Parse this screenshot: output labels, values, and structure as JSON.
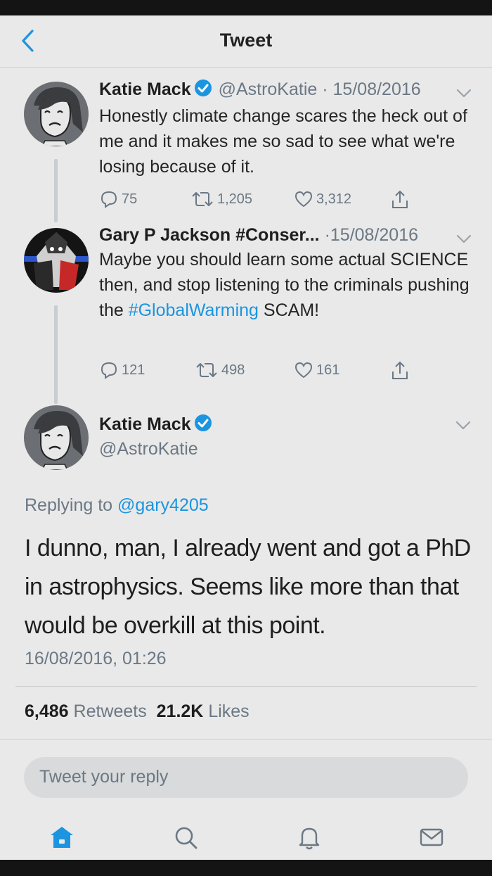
{
  "header": {
    "title": "Tweet"
  },
  "tweets": [
    {
      "name": "Katie Mack",
      "handle": "@AstroKatie",
      "dot": "·",
      "date": "15/08/2016",
      "text": "Honestly climate change scares the heck out of me and it makes me so sad to see what we're losing because of it.",
      "replies": "75",
      "retweets": "1,205",
      "likes": "3,312"
    },
    {
      "name": "Gary P Jackson #Conser...",
      "dot": "·",
      "date": "15/08/2016",
      "text_before": "Maybe you should learn some actual SCIENCE then, and stop listening to the criminals pushing the ",
      "hashtag": "#GlobalWarming",
      "text_after": " SCAM!",
      "replies": "121",
      "retweets": "498",
      "likes": "161"
    }
  ],
  "main_tweet": {
    "name": "Katie Mack",
    "handle": "@AstroKatie",
    "replying_label": "Replying to",
    "replying_handle": "@gary4205",
    "text": "I dunno, man, I already went and got a PhD in astrophysics. Seems like more than that would be overkill at this point.",
    "timestamp": "16/08/2016, 01:26",
    "retweets_count": "6,486",
    "retweets_label": "Retweets",
    "likes_count": "21.2K",
    "likes_label": "Likes"
  },
  "reply": {
    "placeholder": "Tweet your reply"
  },
  "tabbar": [
    "home-icon",
    "search-icon",
    "notifications-icon",
    "messages-icon"
  ],
  "colors": {
    "accent": "#1b95e0",
    "muted": "#6b7884",
    "background": "#e9e9e9"
  }
}
